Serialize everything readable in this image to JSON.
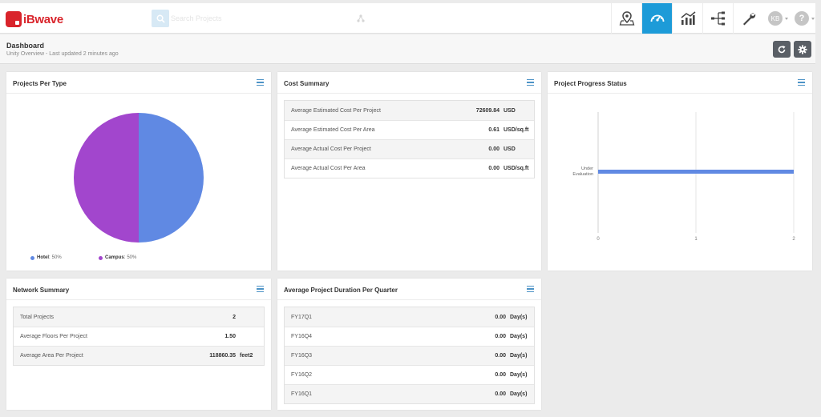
{
  "app": {
    "name": "iBwave"
  },
  "search": {
    "placeholder": "Search Projects"
  },
  "nav": {
    "items": [
      {
        "name": "map-pin-icon",
        "active": false
      },
      {
        "name": "dashboard-gauge-icon",
        "active": true
      },
      {
        "name": "analytics-chart-icon",
        "active": false
      },
      {
        "name": "hierarchy-icon",
        "active": false
      },
      {
        "name": "wrench-icon",
        "active": false
      }
    ]
  },
  "user": {
    "initials": "KB",
    "help": "?"
  },
  "header": {
    "title": "Dashboard",
    "subtitle": "Unity Overview - Last updated 2 minutes ago"
  },
  "panels": {
    "projects_per_type": {
      "title": "Projects Per Type",
      "legend": [
        {
          "label": "Hotel",
          "pct": "50%",
          "color": "#6089e3"
        },
        {
          "label": "Campus",
          "pct": "50%",
          "color": "#a246cd"
        }
      ]
    },
    "cost_summary": {
      "title": "Cost Summary",
      "rows": [
        {
          "label": "Average Estimated Cost Per Project",
          "value": "72609.84",
          "unit": "USD"
        },
        {
          "label": "Average Estimated Cost Per Area",
          "value": "0.61",
          "unit": "USD/sq.ft"
        },
        {
          "label": "Average Actual Cost Per Project",
          "value": "0.00",
          "unit": "USD"
        },
        {
          "label": "Average Actual Cost Per Area",
          "value": "0.00",
          "unit": "USD/sq.ft"
        }
      ]
    },
    "project_progress": {
      "title": "Project Progress Status"
    },
    "network_summary": {
      "title": "Network Summary",
      "rows": [
        {
          "label": "Total Projects",
          "value": "2",
          "unit": ""
        },
        {
          "label": "Average Floors Per Project",
          "value": "1.50",
          "unit": ""
        },
        {
          "label": "Average Area Per Project",
          "value": "118860.35",
          "unit": "feet2"
        }
      ]
    },
    "duration": {
      "title": "Average Project Duration Per Quarter",
      "rows": [
        {
          "label": "FY17Q1",
          "value": "0.00",
          "unit": "Day(s)"
        },
        {
          "label": "FY16Q4",
          "value": "0.00",
          "unit": "Day(s)"
        },
        {
          "label": "FY16Q3",
          "value": "0.00",
          "unit": "Day(s)"
        },
        {
          "label": "FY16Q2",
          "value": "0.00",
          "unit": "Day(s)"
        },
        {
          "label": "FY16Q1",
          "value": "0.00",
          "unit": "Day(s)"
        }
      ]
    }
  },
  "chart_data": [
    {
      "type": "pie",
      "categories": [
        "Hotel",
        "Campus"
      ],
      "values": [
        50,
        50
      ],
      "colors": [
        "#6089e3",
        "#a246cd"
      ],
      "legend": "bottom-left"
    },
    {
      "type": "bar",
      "orientation": "horizontal",
      "categories": [
        "Under Evaluation"
      ],
      "values": [
        2
      ],
      "xlim": [
        0,
        2
      ],
      "xticks": [
        "0",
        "1",
        "2"
      ],
      "color": "#6089e3",
      "grid": true
    }
  ]
}
